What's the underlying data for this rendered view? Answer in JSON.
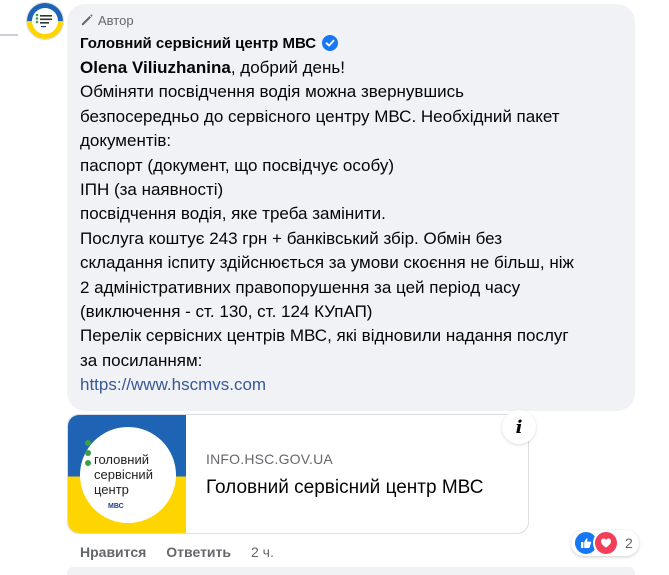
{
  "comment": {
    "author_badge": "Автор",
    "page_name": "Головний сервісний центр МВС",
    "mention": "Olena Viliuzhanina",
    "message_lines": [
      ", добрий день!",
      "Обміняти посвідчення водія можна звернувшись",
      "безпосередньо до сервісного центру МВС. Необхідний пакет",
      "документів:",
      "паспорт (документ, що посвідчує особу)",
      "ІПН (за наявності)",
      "посвідчення водія, яке треба замінити.",
      "Послуга коштує 243 грн + банківський збір. Обмін без",
      "складання іспиту здійснюється за умови скоєння не більш, ніж",
      "2 адміністративних правопорушення за цей період часу",
      "(виключення - ст. 130, ст. 124 КУпАП)",
      "Перелік сервісних центрів МВС, які відновили надання послуг",
      "за посиланням:"
    ],
    "link": "https://www.hscmvs.com"
  },
  "link_card": {
    "domain": "INFO.HSC.GOV.UA",
    "title": "Головний сервісний центр МВС",
    "thumb_text": [
      "головний",
      "сервісний",
      "центр"
    ],
    "thumb_small": "МВС",
    "info_icon": "info-icon"
  },
  "actions": {
    "like": "Нравится",
    "reply": "Ответить",
    "time": "2 ч."
  },
  "reactions": {
    "count": "2",
    "icons": [
      "like-icon",
      "love-icon"
    ]
  },
  "colors": {
    "bubble": "#f0f2f5",
    "link": "#385898",
    "verified": "#1877f2",
    "thumb_blue": "#1e63b4",
    "thumb_yellow": "#ffd500"
  }
}
